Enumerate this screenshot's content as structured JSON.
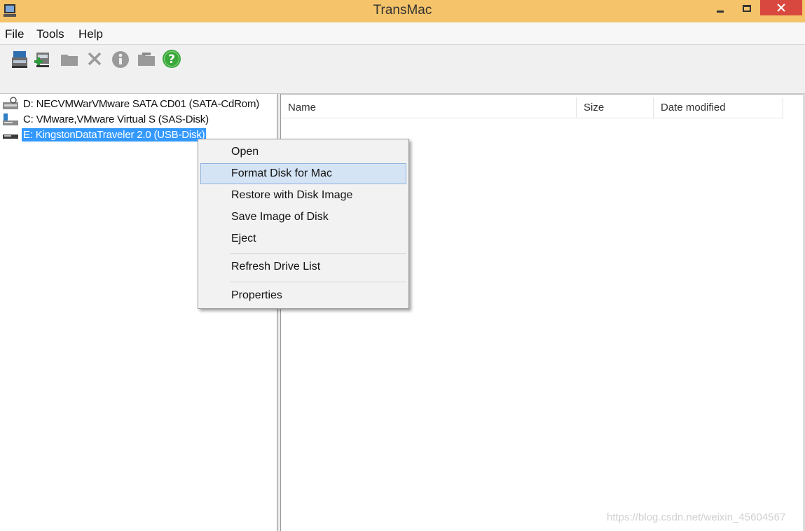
{
  "window": {
    "title": "TransMac"
  },
  "menu": {
    "items": [
      "File",
      "Tools",
      "Help"
    ]
  },
  "toolbar": {
    "icons": [
      "drive-open-icon",
      "drive-add-icon",
      "folder-icon",
      "delete-icon",
      "info-icon",
      "folder-open-icon",
      "help-icon"
    ]
  },
  "drives": [
    {
      "label": "D: NECVMWarVMware SATA CD01 (SATA-CdRom)",
      "icon": "cdrom-drive-icon"
    },
    {
      "label": "C: VMware,VMware Virtual S (SAS-Disk)",
      "icon": "hard-disk-icon"
    },
    {
      "label": "E: KingstonDataTraveler 2.0 (USB-Disk)",
      "icon": "usb-drive-icon",
      "selected": true
    }
  ],
  "file_list": {
    "columns": {
      "name": "Name",
      "size": "Size",
      "date": "Date modified"
    }
  },
  "context_menu": {
    "items": [
      {
        "label": "Open"
      },
      {
        "label": "Format Disk for Mac",
        "highlighted": true
      },
      {
        "label": "Restore with Disk Image"
      },
      {
        "label": "Save Image of Disk"
      },
      {
        "label": "Eject"
      },
      {
        "label": "Refresh Drive List"
      },
      {
        "label": "Properties"
      }
    ]
  },
  "watermark": "https://blog.csdn.net/weixin_45604567",
  "colors": {
    "titlebar": "#f4c36a",
    "selection": "#3399ff",
    "close": "#d9483f",
    "menu_hover": "#d5e4f5"
  }
}
